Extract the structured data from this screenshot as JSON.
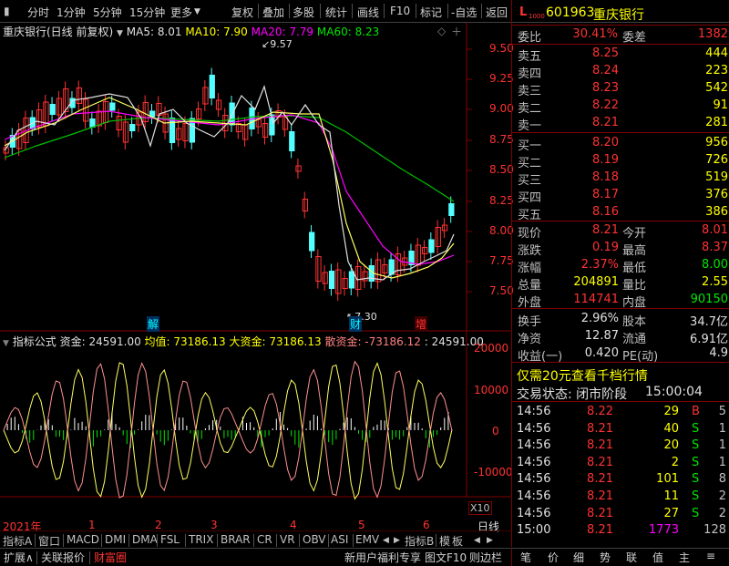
{
  "toolbar": {
    "left_items": [
      "分时",
      "1分钟",
      "5分钟",
      "15分钟",
      "更多"
    ],
    "right_items": [
      "复权",
      "叠加",
      "多股",
      "统计",
      "画线",
      "F10",
      "标记",
      "-自选",
      "返回"
    ]
  },
  "kline_header": {
    "title": "重庆银行(日线 前复权)",
    "ma5": "MA5: 8.01",
    "ma10": "MA10: 7.90",
    "ma20": "MA20: 7.79",
    "ma60": "MA60: 8.23"
  },
  "kline": {
    "high_label": "9.57",
    "low_label": "7.30",
    "price_ticks": [
      "9.50",
      "9.25",
      "9.00",
      "8.75",
      "8.50",
      "8.25",
      "8.00",
      "7.75",
      "7.50"
    ],
    "markers": [
      "解",
      "财",
      "增"
    ]
  },
  "indicator_header": {
    "name": "指标公式",
    "text1": "资金: 24591.00",
    "text2": "均值: 73186.13",
    "text3": "大资金: 73186.13",
    "text4": "散资金: -73186.12",
    "text5": ": 24591.00"
  },
  "indicator": {
    "ticks": [
      "20000",
      "10000",
      "0",
      "-10000"
    ],
    "unit": "X10"
  },
  "time_axis": {
    "year": "2021年",
    "months": [
      "1",
      "2",
      "3",
      "4",
      "5",
      "6"
    ],
    "period": "日线"
  },
  "bottom_tabs": {
    "items": [
      "指标A",
      "窗口",
      "MACD",
      "DMI",
      "DMA",
      "FSL",
      "TRIX",
      "BRAR",
      "CR",
      "VR",
      "OBV",
      "ASI",
      "EMV"
    ],
    "right": [
      "指标B",
      "模",
      "板"
    ]
  },
  "status_bar": {
    "left": [
      "扩展∧",
      "关联报价",
      "财富圈"
    ],
    "right": [
      "新用户福利专享",
      "图文F10",
      "则边栏"
    ],
    "panel_tabs": [
      "笔",
      "价",
      "细",
      "势",
      "联",
      "值",
      "主",
      "≡"
    ]
  },
  "stock": {
    "prefix": "L",
    "code": "601963",
    "name": "重庆银行",
    "weibi_label": "委比",
    "weibi": "30.41%",
    "weicha_label": "委差",
    "weicha": "1382"
  },
  "asks": [
    {
      "label": "卖五",
      "price": "8.25",
      "vol": "444"
    },
    {
      "label": "卖四",
      "price": "8.24",
      "vol": "223"
    },
    {
      "label": "卖三",
      "price": "8.23",
      "vol": "542"
    },
    {
      "label": "卖二",
      "price": "8.22",
      "vol": "91"
    },
    {
      "label": "卖一",
      "price": "8.21",
      "vol": "281"
    }
  ],
  "bids": [
    {
      "label": "买一",
      "price": "8.20",
      "vol": "956"
    },
    {
      "label": "买二",
      "price": "8.19",
      "vol": "726"
    },
    {
      "label": "买三",
      "price": "8.18",
      "vol": "519"
    },
    {
      "label": "买四",
      "price": "8.17",
      "vol": "376"
    },
    {
      "label": "买五",
      "price": "8.16",
      "vol": "386"
    }
  ],
  "quote": [
    {
      "l1": "现价",
      "v1": "8.21",
      "l2": "今开",
      "v2": "8.01"
    },
    {
      "l1": "涨跌",
      "v1": "0.19",
      "l2": "最高",
      "v2": "8.37"
    },
    {
      "l1": "涨幅",
      "v1": "2.37%",
      "l2": "最低",
      "v2": "8.00"
    },
    {
      "l1": "总量",
      "v1": "204891",
      "l2": "量比",
      "v2": "2.55"
    },
    {
      "l1": "外盘",
      "v1": "114741",
      "l2": "内盘",
      "v2": "90150"
    }
  ],
  "stats": [
    {
      "l1": "换手",
      "v1": "2.96%",
      "l2": "股本",
      "v2": "34.7亿"
    },
    {
      "l1": "净资",
      "v1": "12.87",
      "l2": "流通",
      "v2": "6.91亿"
    },
    {
      "l1": "收益(一)",
      "v1": "0.420",
      "l2": "PE(动)",
      "v2": "4.9"
    }
  ],
  "promo": "仅需20元查看千档行情",
  "trade_status": {
    "label": "交易状态: 闭市阶段",
    "time": "15:00:04"
  },
  "ticks": [
    {
      "time": "14:56",
      "price": "8.22",
      "vol": "29",
      "bs": "B",
      "n": "5"
    },
    {
      "time": "14:56",
      "price": "8.21",
      "vol": "40",
      "bs": "S",
      "n": "1"
    },
    {
      "time": "14:56",
      "price": "8.21",
      "vol": "20",
      "bs": "S",
      "n": "1"
    },
    {
      "time": "14:56",
      "price": "8.21",
      "vol": "2",
      "bs": "S",
      "n": "1"
    },
    {
      "time": "14:56",
      "price": "8.21",
      "vol": "101",
      "bs": "S",
      "n": "8"
    },
    {
      "time": "14:56",
      "price": "8.21",
      "vol": "11",
      "bs": "S",
      "n": "2"
    },
    {
      "time": "14:56",
      "price": "8.21",
      "vol": "27",
      "bs": "S",
      "n": "2"
    },
    {
      "time": "15:00",
      "price": "8.21",
      "vol": "1773",
      "bs": "",
      "n": "128"
    }
  ]
}
